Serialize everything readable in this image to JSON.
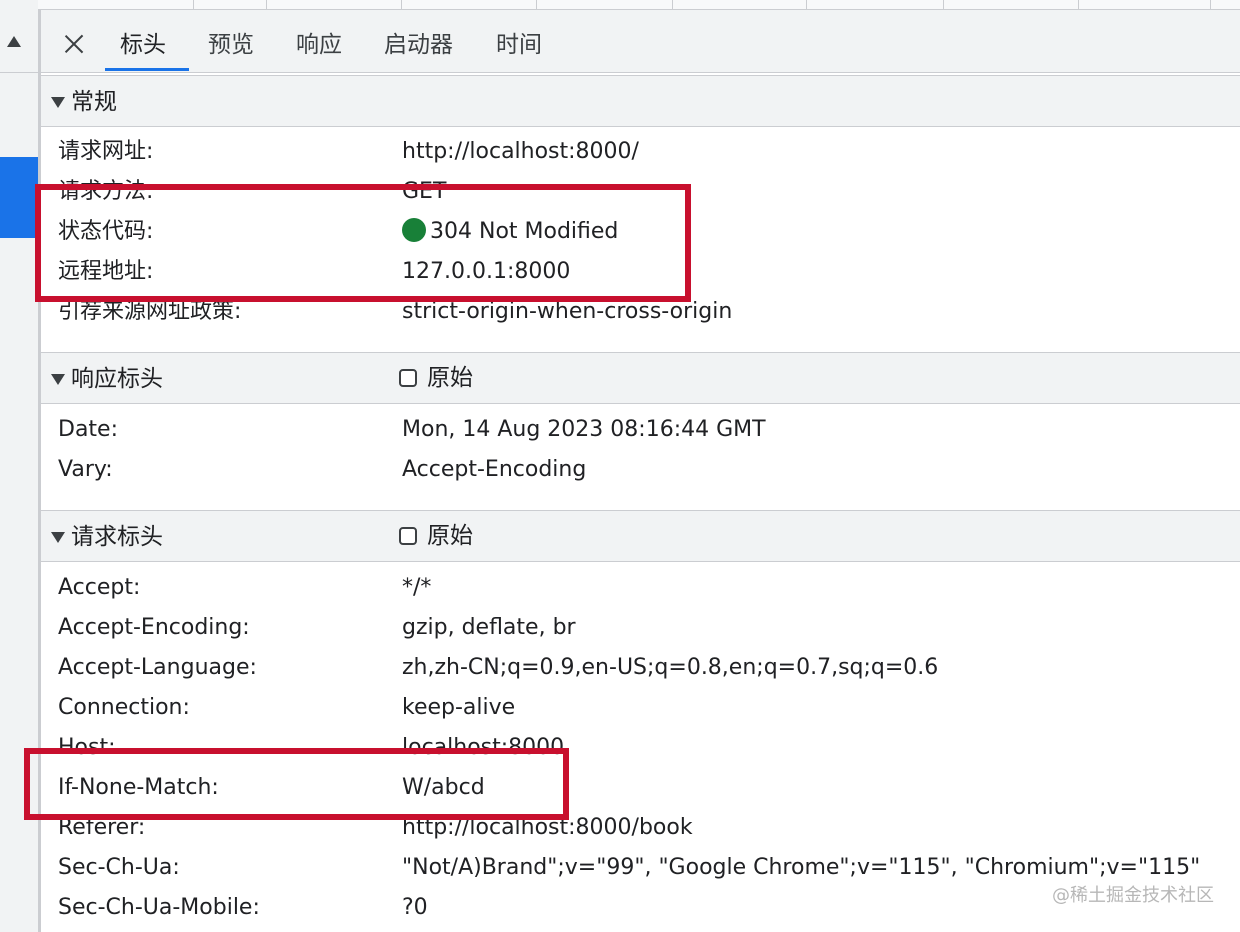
{
  "tabs": {
    "close_icon": "close-icon",
    "items": [
      {
        "label": "标头",
        "active": true
      },
      {
        "label": "预览",
        "active": false
      },
      {
        "label": "响应",
        "active": false
      },
      {
        "label": "启动器",
        "active": false
      },
      {
        "label": "时间",
        "active": false
      }
    ]
  },
  "general": {
    "title": "常规",
    "rows": [
      {
        "key": "请求网址:",
        "value": "http://localhost:8000/"
      },
      {
        "key": "请求方法:",
        "value": "GET"
      },
      {
        "key": "状态代码:",
        "value": "304 Not Modified"
      },
      {
        "key": "远程地址:",
        "value": "127.0.0.1:8000"
      },
      {
        "key": "引荐来源网址政策:",
        "value": "strict-origin-when-cross-origin"
      }
    ]
  },
  "response_headers": {
    "title": "响应标头",
    "raw_label": "原始",
    "rows": [
      {
        "key": "Date:",
        "value": "Mon, 14 Aug 2023 08:16:44 GMT"
      },
      {
        "key": "Vary:",
        "value": "Accept-Encoding"
      }
    ]
  },
  "request_headers": {
    "title": "请求标头",
    "raw_label": "原始",
    "rows": [
      {
        "key": "Accept:",
        "value": "*/*"
      },
      {
        "key": "Accept-Encoding:",
        "value": "gzip, deflate, br"
      },
      {
        "key": "Accept-Language:",
        "value": "zh,zh-CN;q=0.9,en-US;q=0.8,en;q=0.7,sq;q=0.6"
      },
      {
        "key": "Connection:",
        "value": "keep-alive"
      },
      {
        "key": "Host:",
        "value": "localhost:8000"
      },
      {
        "key": "If-None-Match:",
        "value": "W/abcd"
      },
      {
        "key": "Referer:",
        "value": "http://localhost:8000/book"
      },
      {
        "key": "Sec-Ch-Ua:",
        "value": "\"Not/A)Brand\";v=\"99\", \"Google Chrome\";v=\"115\", \"Chromium\";v=\"115\""
      },
      {
        "key": "Sec-Ch-Ua-Mobile:",
        "value": "?0"
      }
    ]
  },
  "colors": {
    "accent": "#1a73e8",
    "status_ok": "#188038",
    "highlight": "#c8102e",
    "header_bg": "#f1f3f4"
  },
  "watermark": "@稀土掘金技术社区"
}
